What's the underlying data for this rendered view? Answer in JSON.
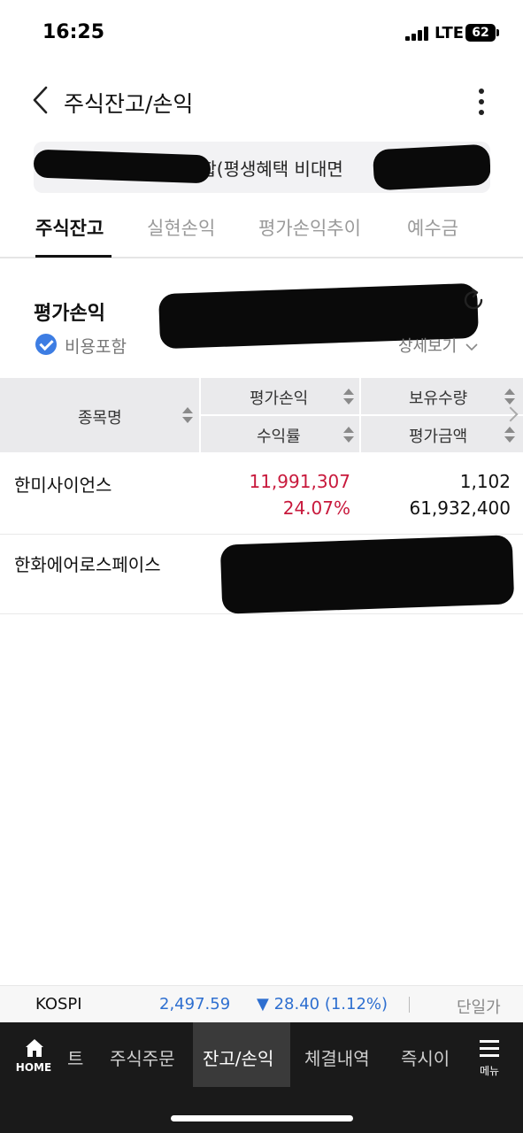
{
  "status_bar": {
    "time": "16:25",
    "network": "LTE",
    "battery": "62"
  },
  "header": {
    "title": "주식잔고/손익",
    "back_icon": "chevron-left-icon",
    "more_icon": "more-vertical-icon"
  },
  "account": {
    "label": "종합(평생혜택 비대면"
  },
  "tabs": [
    {
      "label": "주식잔고",
      "active": true
    },
    {
      "label": "실현손익",
      "active": false
    },
    {
      "label": "평가손익추이",
      "active": false
    },
    {
      "label": "예수금",
      "active": false
    }
  ],
  "summary": {
    "title": "평가손익",
    "include_fee_label": "비용포함",
    "detail_label": "상세보기",
    "refresh_icon": "refresh-icon"
  },
  "table": {
    "col_name": "종목명",
    "col_pl": "평가손익",
    "col_rate": "수익률",
    "col_qty": "보유수량",
    "col_value": "평가금액",
    "rows": [
      {
        "name": "한미사이언스",
        "pl": "11,991,307",
        "rate": "24.07%",
        "qty": "1,102",
        "value": "61,932,400"
      },
      {
        "name": "한화에어로스페이스"
      }
    ]
  },
  "index_bar": {
    "name": "KOSPI",
    "value": "2,497.59",
    "change": "▼ 28.40 (1.12%)",
    "right_label": "단일가",
    "down_color": "#2e6fd0"
  },
  "bottom_nav": {
    "home_label": "HOME",
    "items": [
      {
        "label": "트",
        "active": false
      },
      {
        "label": "주식주문",
        "active": false
      },
      {
        "label": "잔고/손익",
        "active": true
      },
      {
        "label": "체결내역",
        "active": false
      },
      {
        "label": "즉시이",
        "active": false
      }
    ],
    "menu_label": "메뉴"
  },
  "colors": {
    "profit": "#c8193c",
    "accent": "#3d7de3",
    "nav_bg": "#1a1a1a"
  }
}
